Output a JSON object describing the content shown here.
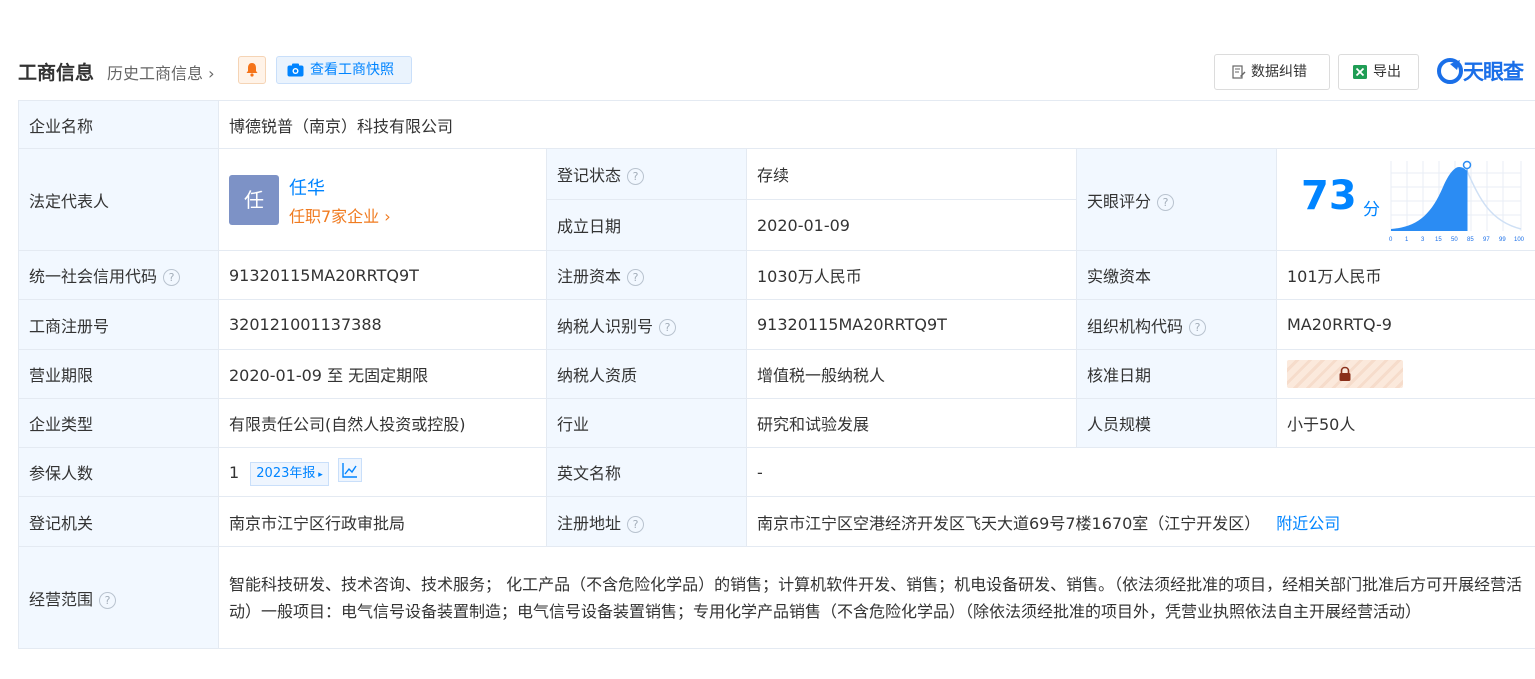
{
  "header": {
    "title": "工商信息",
    "history_link": "历史工商信息",
    "snapshot_button": "查看工商快照",
    "correct_button": "数据纠错",
    "export_button": "导出",
    "logo_text": "天眼查"
  },
  "labels": {
    "company_name": "企业名称",
    "legal_rep": "法定代表人",
    "reg_status": "登记状态",
    "founded_date": "成立日期",
    "tianyan_score": "天眼评分",
    "credit_code": "统一社会信用代码",
    "reg_capital": "注册资本",
    "paid_capital": "实缴资本",
    "biz_reg_no": "工商注册号",
    "taxpayer_id": "纳税人识别号",
    "org_code": "组织机构代码",
    "biz_term": "营业期限",
    "taxpayer_qual": "纳税人资质",
    "approval_date": "核准日期",
    "company_type": "企业类型",
    "industry": "行业",
    "staff_size": "人员规模",
    "insured": "参保人数",
    "english_name": "英文名称",
    "reg_authority": "登记机关",
    "reg_address": "注册地址",
    "biz_scope": "经营范围"
  },
  "values": {
    "company_name": "博德锐普（南京）科技有限公司",
    "legal_rep_avatar": "任",
    "legal_rep_name": "任华",
    "legal_rep_jobs": "任职7家企业",
    "reg_status": "存续",
    "founded_date": "2020-01-09",
    "score": "73",
    "score_unit": "分",
    "credit_code": "91320115MA20RRTQ9T",
    "reg_capital": "1030万人民币",
    "paid_capital": "101万人民币",
    "biz_reg_no": "320121001137388",
    "taxpayer_id": "91320115MA20RRTQ9T",
    "org_code": "MA20RRTQ-9",
    "biz_term": "2020-01-09 至 无固定期限",
    "taxpayer_qual": "增值税一般纳税人",
    "company_type": "有限责任公司(自然人投资或控股)",
    "industry": "研究和试验发展",
    "staff_size": "小于50人",
    "insured_count": "1",
    "insured_report": "2023年报",
    "english_name": "-",
    "reg_authority": "南京市江宁区行政审批局",
    "reg_address": "南京市江宁区空港经济开发区飞天大道69号7楼1670室（江宁开发区）",
    "nearby_link": "附近公司",
    "biz_scope": "智能科技研发、技术咨询、技术服务； 化工产品（不含危险化学品）的销售；计算机软件开发、销售；机电设备研发、销售。（依法须经批准的项目，经相关部门批准后方可开展经营活动）一般项目：电气信号设备装置制造；电气信号设备装置销售；专用化学产品销售（不含危险化学品）（除依法须经批准的项目外，凭营业执照依法自主开展经营活动）"
  },
  "score_chart": {
    "x_ticks": [
      "0",
      "1",
      "3",
      "15",
      "50",
      "85",
      "97",
      "99",
      "100"
    ]
  },
  "icons": {
    "bell": "bell-icon",
    "camera": "camera-icon",
    "correct": "edit-doc-icon",
    "export": "excel-icon",
    "help": "question-icon",
    "lock": "lock-icon",
    "trend": "trend-chart-icon"
  },
  "colors": {
    "accent": "#0084ff",
    "label_bg": "#f2f8ff",
    "active_status": "#2e9f4e",
    "orange": "#f07b20"
  }
}
